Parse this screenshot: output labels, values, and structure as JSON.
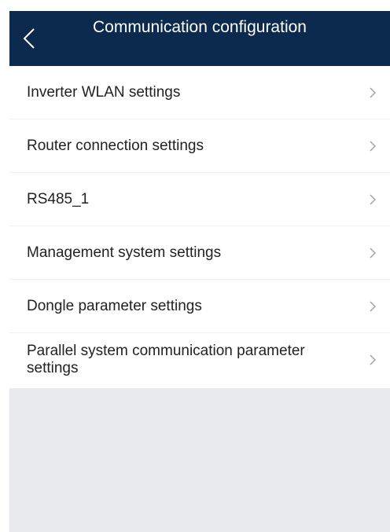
{
  "header": {
    "title": "Communication configuration",
    "back_icon": "chevron-left-icon"
  },
  "menu": {
    "items": [
      {
        "label": "Inverter WLAN settings",
        "icon": "chevron-right-icon"
      },
      {
        "label": "Router connection settings",
        "icon": "chevron-right-icon"
      },
      {
        "label": "RS485_1",
        "icon": "chevron-right-icon"
      },
      {
        "label": "Management system settings",
        "icon": "chevron-right-icon"
      },
      {
        "label": "Dongle parameter settings",
        "icon": "chevron-right-icon"
      },
      {
        "label": "Parallel system communication parameter settings",
        "icon": "chevron-right-icon"
      }
    ]
  },
  "colors": {
    "header_bg": "#0c2a4d",
    "header_text": "#ffffff",
    "item_text": "#222222",
    "divider": "#eeeff2",
    "chevron": "#9a9a9a",
    "empty_area": "#e9eaee"
  }
}
